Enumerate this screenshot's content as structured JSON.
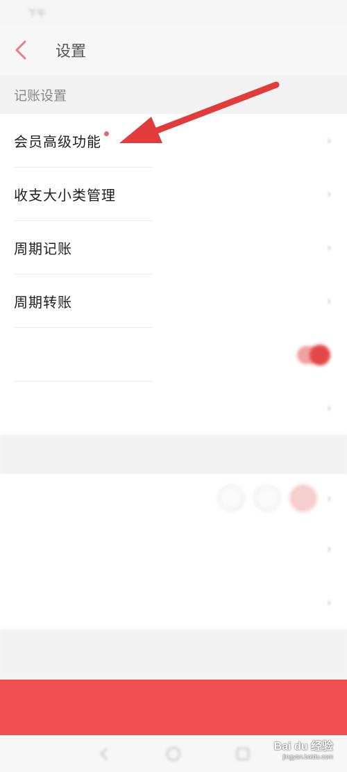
{
  "status_bar": {
    "left": "下午",
    "right": ""
  },
  "nav": {
    "title": "设置"
  },
  "sections": {
    "bookkeeping": {
      "header": "记账设置"
    },
    "theme": {
      "header": ""
    },
    "misc": {
      "header": ""
    }
  },
  "items": [
    {
      "label": "会员高级功能",
      "value": "",
      "has_badge": true,
      "blurred": false
    },
    {
      "label": "收支大小类管理",
      "value": "",
      "blurred": false
    },
    {
      "label": "周期记账",
      "value": "",
      "blurred": false
    },
    {
      "label": "周期转账",
      "value": "",
      "blurred": false
    },
    {
      "label": "",
      "blurred": true,
      "control": "toggle",
      "toggle_on": true
    },
    {
      "label": "",
      "value": "",
      "blurred": true
    }
  ],
  "theme_items": [
    {
      "label": "",
      "blurred": true,
      "control": "theme-dots"
    },
    {
      "label": "",
      "blurred": true
    },
    {
      "label": "",
      "value": "",
      "blurred": true
    }
  ],
  "logout": {
    "label": ""
  },
  "watermark": {
    "brand": "Bai du 经验",
    "url": "jingyan.baidu.com"
  },
  "colors": {
    "accent": "#f05050",
    "arrow": "#e23b3b",
    "badge": "#e26a6a"
  },
  "icons": {
    "back": "chevron-left-icon",
    "chevron": "chevron-right-icon"
  }
}
